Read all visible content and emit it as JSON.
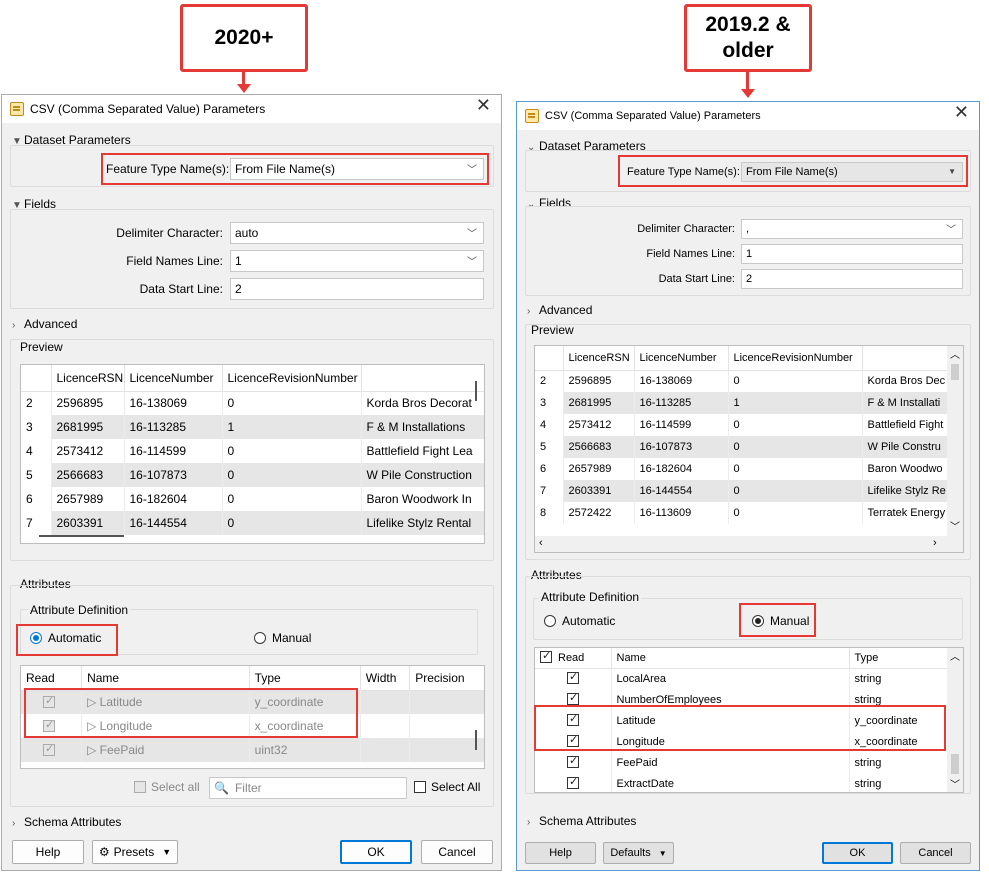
{
  "callouts": {
    "new_version": "2020+",
    "old_version_line1": "2019.2 &",
    "old_version_line2": "older"
  },
  "new_dialog": {
    "title": "CSV (Comma Separated Value) Parameters",
    "dataset_parameters": "Dataset Parameters",
    "feature_type_label": "Feature Type Name(s):",
    "feature_type_value": "From File Name(s)",
    "fields": "Fields",
    "delimiter_label": "Delimiter Character:",
    "delimiter_value": "auto",
    "field_names_label": "Field Names Line:",
    "field_names_value": "1",
    "data_start_label": "Data Start Line:",
    "data_start_value": "2",
    "advanced": "Advanced",
    "preview": "Preview",
    "preview_headers": [
      "LicenceRSN",
      "LicenceNumber",
      "LicenceRevisionNumber",
      ""
    ],
    "preview_rows": [
      [
        "2",
        "2596895",
        "16-138069",
        "0",
        "Korda Bros Decorat"
      ],
      [
        "3",
        "2681995",
        "16-113285",
        "1",
        "F & M Installations"
      ],
      [
        "4",
        "2573412",
        "16-114599",
        "0",
        "Battlefield Fight Lea"
      ],
      [
        "5",
        "2566683",
        "16-107873",
        "0",
        "W Pile Construction"
      ],
      [
        "6",
        "2657989",
        "16-182604",
        "0",
        "Baron Woodwork In"
      ],
      [
        "7",
        "2603391",
        "16-144554",
        "0",
        "Lifelike Stylz Rental"
      ]
    ],
    "attributes": "Attributes",
    "attribute_definition": "Attribute Definition",
    "automatic": "Automatic",
    "manual": "Manual",
    "attr_headers": [
      "Read",
      "Name",
      "Type",
      "Width",
      "Precision"
    ],
    "attr_rows": [
      {
        "name": "Latitude",
        "type": "y_coordinate"
      },
      {
        "name": "Longitude",
        "type": "x_coordinate"
      },
      {
        "name": "FeePaid",
        "type": "uint32"
      }
    ],
    "select_all": "Select all",
    "filter_placeholder": "Filter",
    "select_all_2": "Select All",
    "schema_attributes": "Schema Attributes",
    "help": "Help",
    "presets": "Presets",
    "ok": "OK",
    "cancel": "Cancel"
  },
  "old_dialog": {
    "title": "CSV (Comma Separated Value) Parameters",
    "dataset_parameters": "Dataset Parameters",
    "feature_type_label": "Feature Type Name(s):",
    "feature_type_value": "From File Name(s)",
    "fields": "Fields",
    "delimiter_label": "Delimiter Character:",
    "delimiter_value": ",",
    "field_names_label": "Field Names Line:",
    "field_names_value": "1",
    "data_start_label": "Data Start Line:",
    "data_start_value": "2",
    "advanced": "Advanced",
    "preview": "Preview",
    "preview_headers": [
      "LicenceRSN",
      "LicenceNumber",
      "LicenceRevisionNumber",
      ""
    ],
    "preview_rows": [
      [
        "2",
        "2596895",
        "16-138069",
        "0",
        "Korda Bros Dec"
      ],
      [
        "3",
        "2681995",
        "16-113285",
        "1",
        "F & M Installati"
      ],
      [
        "4",
        "2573412",
        "16-114599",
        "0",
        "Battlefield Fight"
      ],
      [
        "5",
        "2566683",
        "16-107873",
        "0",
        "W Pile Constru"
      ],
      [
        "6",
        "2657989",
        "16-182604",
        "0",
        "Baron Woodwo"
      ],
      [
        "7",
        "2603391",
        "16-144554",
        "0",
        "Lifelike Stylz Re"
      ],
      [
        "8",
        "2572422",
        "16-113609",
        "0",
        "Terratek Energy"
      ]
    ],
    "attributes": "Attributes",
    "attribute_definition": "Attribute Definition",
    "automatic": "Automatic",
    "manual": "Manual",
    "attr_headers": [
      "Read",
      "Name",
      "Type"
    ],
    "attr_rows": [
      {
        "name": "LocalArea",
        "type": "string"
      },
      {
        "name": "NumberOfEmployees",
        "type": "string"
      },
      {
        "name": "Latitude",
        "type": "y_coordinate"
      },
      {
        "name": "Longitude",
        "type": "x_coordinate"
      },
      {
        "name": "FeePaid",
        "type": "string"
      },
      {
        "name": "ExtractDate",
        "type": "string"
      }
    ],
    "schema_attributes": "Schema Attributes",
    "help": "Help",
    "defaults": "Defaults",
    "ok": "OK",
    "cancel": "Cancel"
  },
  "colors": {
    "highlight": "#e53935",
    "accent": "#0078d7"
  }
}
